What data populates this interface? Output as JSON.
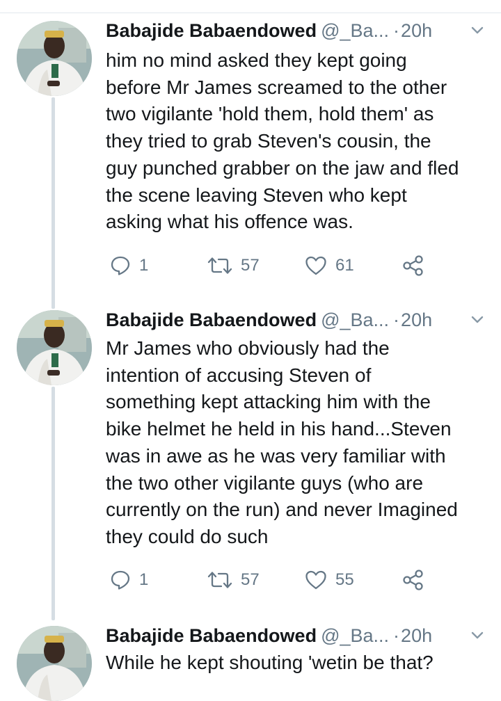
{
  "tweets": [
    {
      "name": "Babajide Babaendowed",
      "handle": "@_Ba...",
      "dot": "·",
      "time": "20h",
      "text": "him no mind asked they kept going\nbefore Mr James screamed to the other\ntwo vigilante 'hold them, hold them' as\nthey tried to grab Steven's cousin, the\nguy punched grabber on the jaw and fled\nthe scene leaving Steven who kept\nasking what his offence was.",
      "replies": "1",
      "retweets": "57",
      "likes": "61"
    },
    {
      "name": "Babajide Babaendowed",
      "handle": "@_Ba...",
      "dot": "·",
      "time": "20h",
      "text": "Mr James who obviously had the\nintention of accusing Steven of\nsomething kept attacking him with the\nbike helmet he held in his hand...Steven\nwas in awe as he was very familiar with\nthe two other vigilante guys (who are\ncurrently on the run) and never Imagined\nthey could do such",
      "replies": "1",
      "retweets": "57",
      "likes": "55"
    },
    {
      "name": "Babajide Babaendowed",
      "handle": "@_Ba...",
      "dot": "·",
      "time": "20h",
      "text": "While he kept shouting 'wetin be that?"
    }
  ],
  "icons": {
    "reply": "reply-icon",
    "retweet": "retweet-icon",
    "like": "heart-icon",
    "share": "share-icon",
    "caret": "chevron-down-icon"
  },
  "colors": {
    "text": "#14171a",
    "secondary": "#657786",
    "thread_line": "#d5dde3"
  }
}
